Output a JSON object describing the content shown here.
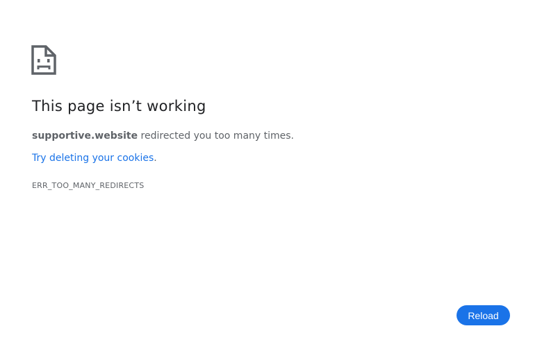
{
  "icon": "sad-page-icon",
  "title": "This page isn’t working",
  "summary": {
    "host": "supportive.website",
    "message": " redirected you too many times."
  },
  "suggestion": {
    "link_text": "Try deleting your cookies",
    "suffix": "."
  },
  "error_code": "ERR_TOO_MANY_REDIRECTS",
  "reload_label": "Reload",
  "colors": {
    "accent": "#1a73e8",
    "text": "#202124",
    "secondary_text": "#5f6368",
    "icon": "#5f6368"
  }
}
